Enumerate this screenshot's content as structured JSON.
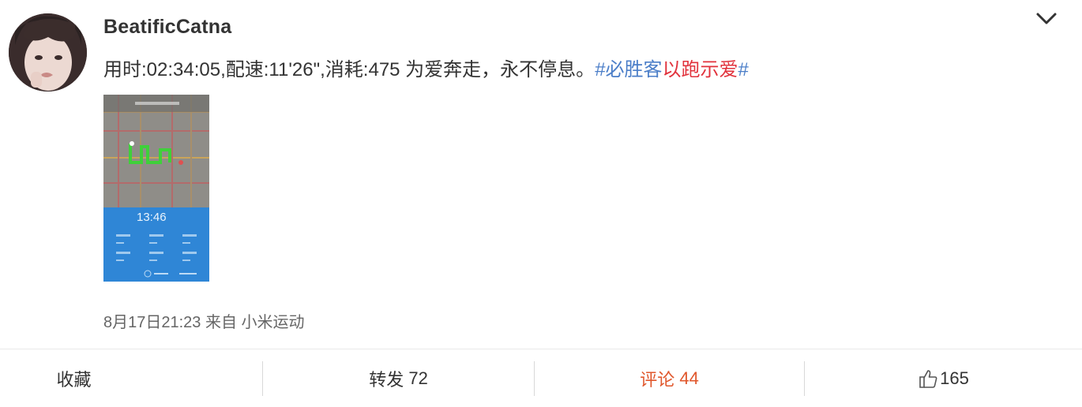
{
  "post": {
    "username": "BeatificCatna",
    "text_main": "用时:02:34:05,配速:11'26\",消耗:475 为爱奔走，永不停息。",
    "tag_hash_open": "#",
    "tag_part_blue": "必胜客",
    "tag_part_red": "以跑示爱",
    "tag_hash_close": "#",
    "timestamp": "8月17日21:23",
    "source_prefix": "来自",
    "source_app": "小米运动"
  },
  "thumbnail": {
    "time_readout": "13:46"
  },
  "actions": {
    "favorite_label": "收藏",
    "repost_label": "转发",
    "repost_count": "72",
    "comment_label": "评论",
    "comment_count": "44",
    "like_count": "165"
  },
  "colors": {
    "tag_blue": "#4b7ec8",
    "tag_red": "#e1323c",
    "comment_accent": "#e0572c"
  },
  "icons": {
    "menu": "chevron-down-icon",
    "like": "thumbs-up-icon"
  }
}
